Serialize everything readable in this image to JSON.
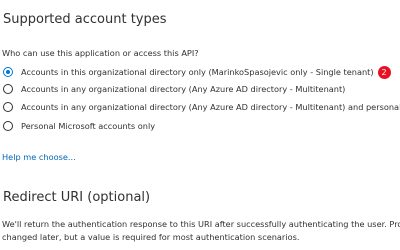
{
  "supported_accounts": {
    "title": "Supported account types",
    "question": "Who can use this application or access this API?",
    "options": [
      {
        "label": "Accounts in this organizational directory only (MarinkoSpasojevic only - Single tenant)",
        "checked": true
      },
      {
        "label": "Accounts in any organizational directory (Any Azure AD directory - Multitenant)",
        "checked": false
      },
      {
        "label": "Accounts in any organizational directory (Any Azure AD directory - Multitenant) and personal",
        "checked": false
      },
      {
        "label": "Personal Microsoft accounts only",
        "checked": false
      }
    ],
    "badge": "2",
    "help_link": "Help me choose..."
  },
  "redirect_uri": {
    "title": "Redirect URI (optional)",
    "description_line1": "We'll return the authentication response to this URI after successfully authenticating the user. Provi",
    "description_line2": "changed later, but a value is required for most authentication scenarios."
  },
  "colors": {
    "accent": "#0078d4",
    "link": "#0067b8",
    "badge": "#e81123",
    "text": "#323130"
  }
}
